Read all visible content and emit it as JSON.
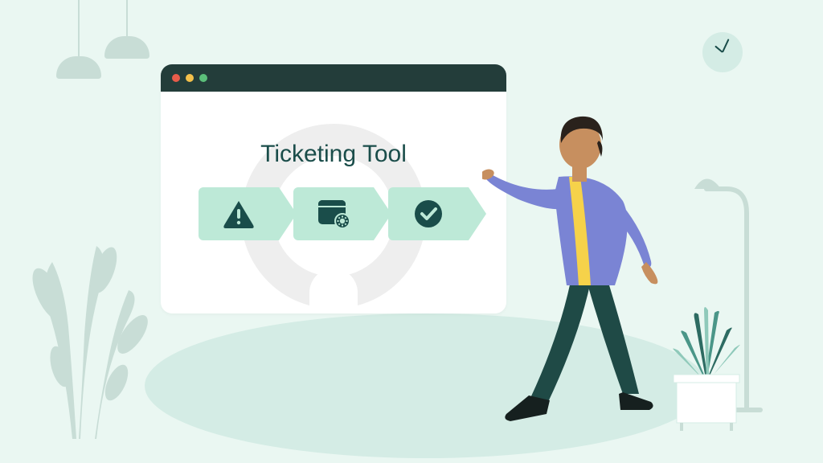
{
  "window": {
    "title": "Ticketing Tool",
    "steps": [
      {
        "icon": "alert-icon"
      },
      {
        "icon": "settings-window-icon"
      },
      {
        "icon": "check-circle-icon"
      }
    ]
  },
  "colors": {
    "background": "#eaf7f2",
    "windowHeader": "#233d3a",
    "stepFill": "#bde9d7",
    "iconDark": "#1a4d4a",
    "textDark": "#1a4d4a"
  }
}
